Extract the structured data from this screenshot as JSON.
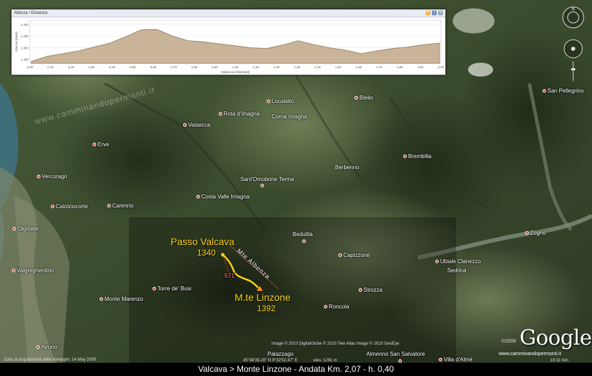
{
  "profile": {
    "title": "Altezza / Distanza",
    "y_axis_label": "Altezza (metri)",
    "x_axis_label": "Distanza (chilometri)",
    "y_ticks": [
      "1.400",
      "1.380",
      "1.360",
      "1.340"
    ],
    "x_ticks": [
      "0,00",
      "0,10",
      "0,20",
      "0,30",
      "0,40",
      "0,50",
      "0,60",
      "0,70",
      "0,80",
      "0,90",
      "1,00",
      "1,10",
      "1,20",
      "1,30",
      "1,40",
      "1,50",
      "1,60",
      "1,70",
      "1,80",
      "1,90",
      "2,00"
    ],
    "icons": [
      "settings-icon",
      "info-icon",
      "close-icon"
    ]
  },
  "places": [
    {
      "id": "locatello",
      "name": "Locatello"
    },
    {
      "id": "blello",
      "name": "Blello"
    },
    {
      "id": "san-pellegrino",
      "name": "San Pellegrino"
    },
    {
      "id": "rota-dimagna",
      "name": "Rota d'Imagna"
    },
    {
      "id": "corna-imagna",
      "name": "Corna Imagna"
    },
    {
      "id": "valsecca",
      "name": "Valsecca"
    },
    {
      "id": "erve",
      "name": "Erve"
    },
    {
      "id": "brembilla",
      "name": "Brembilla"
    },
    {
      "id": "berbenno",
      "name": "Berbenno"
    },
    {
      "id": "santomobone",
      "name": "Sant'Omobone Terme"
    },
    {
      "id": "vercurago",
      "name": "Vercurago"
    },
    {
      "id": "costa-valle",
      "name": "Costa Valle Imagna"
    },
    {
      "id": "calolziocorte",
      "name": "Calolziocorte"
    },
    {
      "id": "carenno",
      "name": "Carenno"
    },
    {
      "id": "olginate",
      "name": "Olginate"
    },
    {
      "id": "zogno",
      "name": "Zogno"
    },
    {
      "id": "bedulita",
      "name": "Bedulita"
    },
    {
      "id": "capizzone",
      "name": "Capizzone"
    },
    {
      "id": "ubiale",
      "name": "Ubiale Clanezzo"
    },
    {
      "id": "sedrina",
      "name": "Sedrina"
    },
    {
      "id": "valgreghentino",
      "name": "Valgreghentino"
    },
    {
      "id": "torre-busi",
      "name": "Torre de' Busi"
    },
    {
      "id": "strozza",
      "name": "Strozza"
    },
    {
      "id": "monte-marenzo",
      "name": "Monte Marenzo"
    },
    {
      "id": "roncola",
      "name": "Roncola"
    },
    {
      "id": "airuno",
      "name": "Airuno"
    },
    {
      "id": "almenno",
      "name": "Almenno San Salvatore"
    },
    {
      "id": "villa-dalme",
      "name": "Villa d'Almè"
    },
    {
      "id": "palazzago",
      "name": "Palazzago"
    }
  ],
  "route": {
    "start_name": "Passo Valcava",
    "start_elev": "1340",
    "end_name": "M.te Linzone",
    "end_elev": "1392",
    "trail_name": "Mte Albenza",
    "trail_number": "571"
  },
  "watermark": "www.camminandopermonti.it",
  "attribution": {
    "imagery_date": "Data di acquisizione delle immagini: 14 May 2009",
    "coords": "45°48'39.28\" N  9°32'52.47\" E",
    "elevation": "elev. 1291 m",
    "eye_alt": "Alt. 5.06 km",
    "credits": "Image © 2010 DigitalGlobe  © 2010 Tele Atlas  Image © 2010 GeoEye",
    "copyright": "©2009",
    "site": "www.camminandopermonti.it",
    "time": "19:11 min"
  },
  "google_logo": "Google",
  "caption": "Valcava  >  Monte Linzone   -   Andata  Km. 2,07  -  h. 0,40",
  "colors": {
    "route": "#ffd21a",
    "profile_fill": "#c9b49a",
    "place_dot": "#c0392b"
  }
}
